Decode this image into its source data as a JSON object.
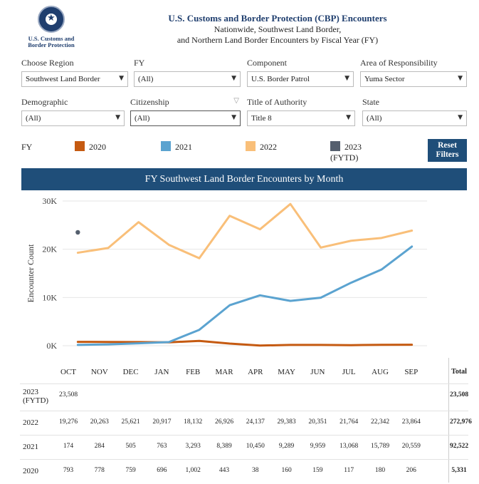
{
  "logo": {
    "line1": "U.S. Customs and",
    "line2": "Border Protection"
  },
  "header": {
    "title": "U.S. Customs and Border Protection (CBP) Encounters",
    "subtitle1": "Nationwide, Southwest Land Border,",
    "subtitle2": "and Northern Land Border Encounters by Fiscal Year (FY)"
  },
  "filters": {
    "region": {
      "label": "Choose Region",
      "value": "Southwest Land Border"
    },
    "fy": {
      "label": "FY",
      "value": "(All)"
    },
    "component": {
      "label": "Component",
      "value": "U.S. Border Patrol"
    },
    "aor": {
      "label": "Area of Responsibility",
      "value": "Yuma Sector"
    },
    "demographic": {
      "label": "Demographic",
      "value": "(All)"
    },
    "citizenship": {
      "label": "Citizenship",
      "value": "(All)"
    },
    "authority": {
      "label": "Title of Authority",
      "value": "Title 8"
    },
    "state": {
      "label": "State",
      "value": "(All)"
    }
  },
  "legend": {
    "label": "FY",
    "items": [
      {
        "name": "2020",
        "color": "#c55a11"
      },
      {
        "name": "2021",
        "color": "#5ba3d0"
      },
      {
        "name": "2022",
        "color": "#f9bf79"
      },
      {
        "name": "2023 (FYTD)",
        "color": "#555f6e"
      }
    ]
  },
  "reset_button": {
    "line1": "Reset",
    "line2": "Filters"
  },
  "chart_data": {
    "type": "line",
    "title": "FY Southwest Land Border Encounters by Month",
    "ylabel": "Encounter Count",
    "ylim": [
      0,
      30000
    ],
    "ytick_labels": [
      "30K",
      "20K",
      "10K",
      "0K"
    ],
    "ytick_values": [
      30000,
      20000,
      10000,
      0
    ],
    "categories": [
      "OCT",
      "NOV",
      "DEC",
      "JAN",
      "FEB",
      "MAR",
      "APR",
      "MAY",
      "JUN",
      "JUL",
      "AUG",
      "SEP"
    ],
    "series": [
      {
        "name": "2020",
        "color": "#c55a11",
        "values": [
          793,
          778,
          759,
          696,
          1002,
          443,
          38,
          160,
          159,
          117,
          180,
          206
        ]
      },
      {
        "name": "2021",
        "color": "#5ba3d0",
        "values": [
          174,
          284,
          505,
          763,
          3293,
          8389,
          10450,
          9289,
          9959,
          13068,
          15789,
          20559
        ]
      },
      {
        "name": "2022",
        "color": "#f9bf79",
        "values": [
          19276,
          20263,
          25621,
          20917,
          18132,
          26926,
          24137,
          29383,
          20351,
          21764,
          22342,
          23864
        ]
      },
      {
        "name": "2023 (FYTD)",
        "color": "#555f6e",
        "values": [
          23508
        ]
      }
    ],
    "grid": true
  },
  "table": {
    "total_header": "Total",
    "rows": [
      {
        "label1": "2023",
        "label2": "(FYTD)",
        "values": [
          "23,508",
          "",
          "",
          "",
          "",
          "",
          "",
          "",
          "",
          "",
          "",
          ""
        ],
        "total": "23,508"
      },
      {
        "label1": "2022",
        "label2": "",
        "values": [
          "19,276",
          "20,263",
          "25,621",
          "20,917",
          "18,132",
          "26,926",
          "24,137",
          "29,383",
          "20,351",
          "21,764",
          "22,342",
          "23,864"
        ],
        "total": "272,976"
      },
      {
        "label1": "2021",
        "label2": "",
        "values": [
          "174",
          "284",
          "505",
          "763",
          "3,293",
          "8,389",
          "10,450",
          "9,289",
          "9,959",
          "13,068",
          "15,789",
          "20,559"
        ],
        "total": "92,522"
      },
      {
        "label1": "2020",
        "label2": "",
        "values": [
          "793",
          "778",
          "759",
          "696",
          "1,002",
          "443",
          "38",
          "160",
          "159",
          "117",
          "180",
          "206"
        ],
        "total": "5,331"
      }
    ]
  }
}
